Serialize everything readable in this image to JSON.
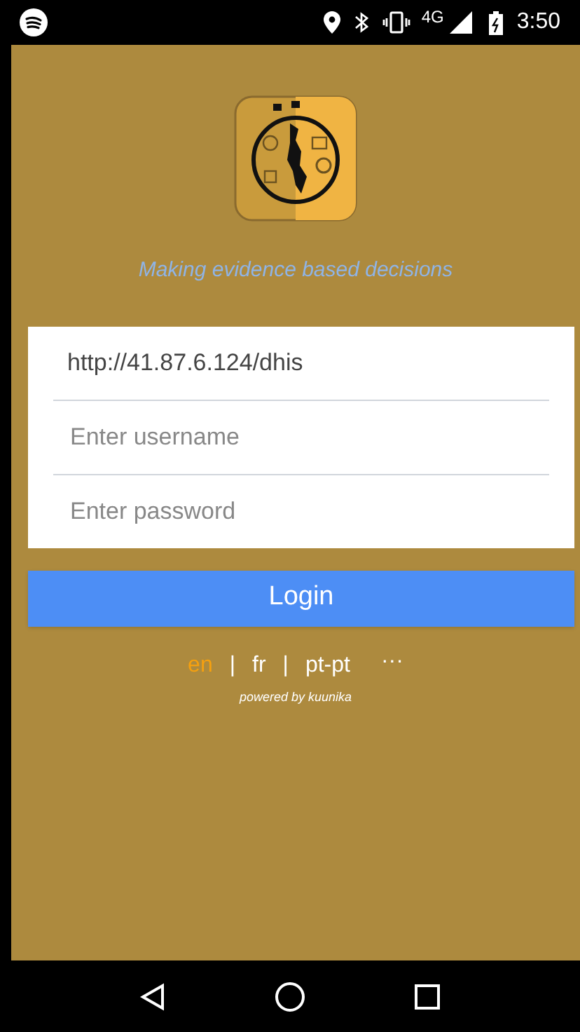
{
  "status_bar": {
    "network": "4G",
    "time": "3:50"
  },
  "tagline": "Making evidence based decisions",
  "form": {
    "server": "http://41.87.6.124/dhis",
    "username": {
      "placeholder": "Enter username"
    },
    "password": {
      "placeholder": "Enter password"
    }
  },
  "login_button": "Login",
  "languages": [
    {
      "label": "en",
      "selected": true
    },
    {
      "label": "fr",
      "selected": false
    },
    {
      "label": "pt-pt",
      "selected": false
    }
  ],
  "separator": "|",
  "more": "···",
  "powered_by": "powered by kuunika"
}
